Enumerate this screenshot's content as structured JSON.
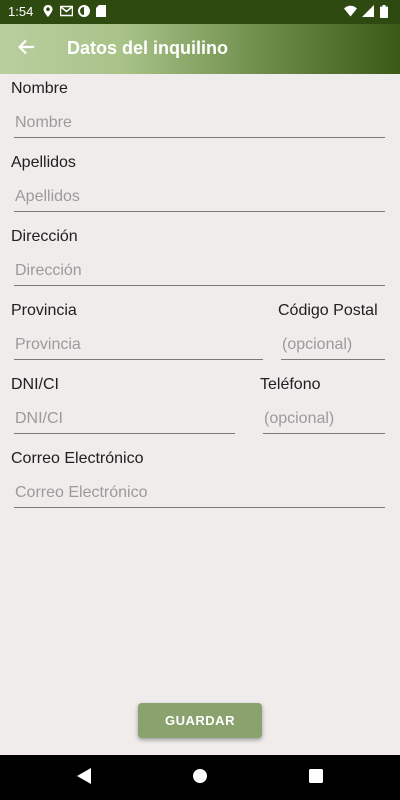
{
  "status_bar": {
    "time": "1:54",
    "left_icons": [
      "location-icon",
      "gmail-icon",
      "data-saver-icon",
      "sd-card-icon"
    ],
    "right_icons": [
      "wifi-icon",
      "cell-signal-icon",
      "battery-icon"
    ]
  },
  "app_bar": {
    "back_icon": "arrow-back-icon",
    "title": "Datos del inquilino"
  },
  "form": {
    "nombre": {
      "label": "Nombre",
      "placeholder": "Nombre"
    },
    "apellidos": {
      "label": "Apellidos",
      "placeholder": "Apellidos"
    },
    "direccion": {
      "label": "Dirección",
      "placeholder": "Dirección"
    },
    "provincia": {
      "label": "Provincia",
      "placeholder": "Provincia"
    },
    "codigo_postal": {
      "label": "Código Postal",
      "placeholder": "(opcional)"
    },
    "dni": {
      "label": "DNI/CI",
      "placeholder": "DNI/CI"
    },
    "telefono": {
      "label": "Teléfono",
      "placeholder": "(opcional)"
    },
    "correo": {
      "label": "Correo Electrónico",
      "placeholder": "Correo Electrónico"
    }
  },
  "actions": {
    "save_label": "GUARDAR"
  },
  "nav_bar": {
    "buttons": [
      "back-triangle-icon",
      "home-circle-icon",
      "recents-square-icon"
    ]
  },
  "colors": {
    "status_bar": "#2f4a11",
    "background": "#efeceb",
    "save_button": "#8aa26d",
    "nav_bar": "#000000"
  }
}
